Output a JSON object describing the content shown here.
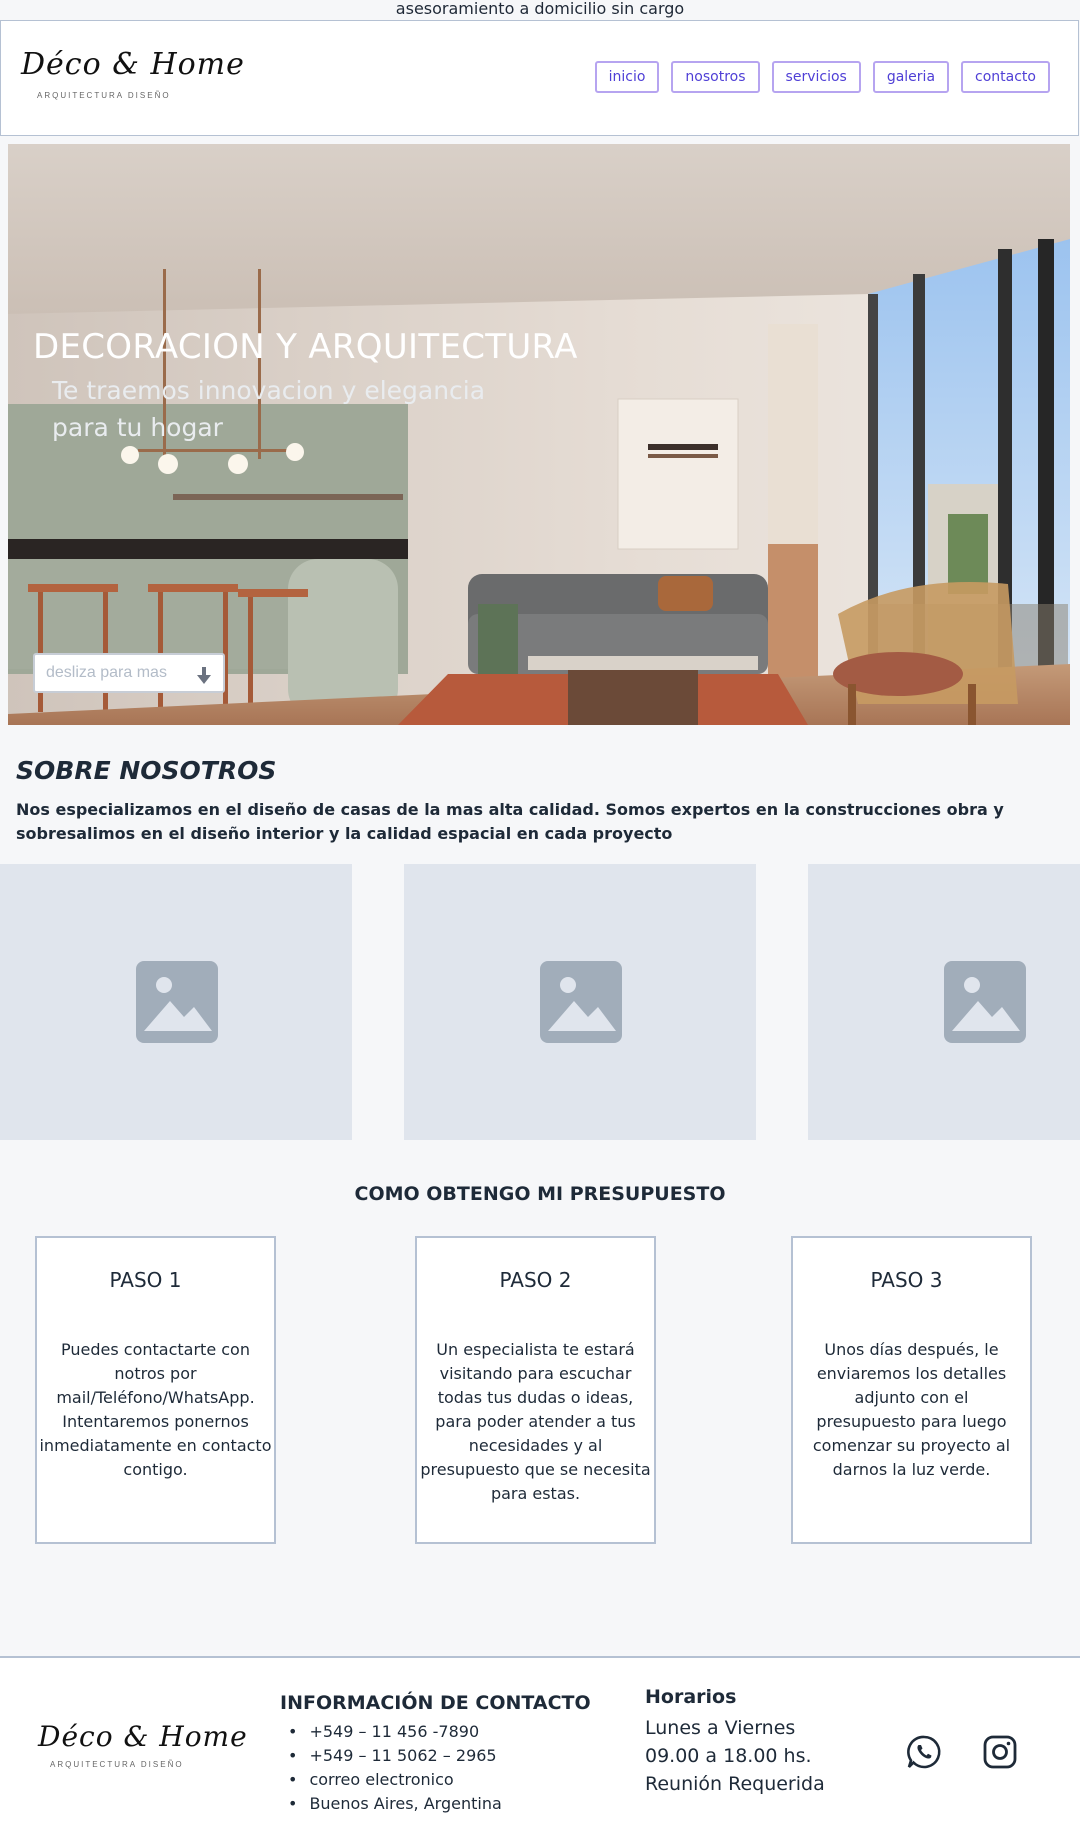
{
  "topbar": {
    "text": "asesoramiento a domicilio sin cargo"
  },
  "brand": {
    "script": "Déco & Home",
    "tagline": "ARQUITECTURA DISEÑO"
  },
  "nav": {
    "items": [
      "inicio",
      "nosotros",
      "servicios",
      "galeria",
      "contacto"
    ],
    "accent": "#4f3fd6"
  },
  "hero": {
    "title": "DECORACION Y ARQUITECTURA",
    "subtitle": "Te traemos innovacion y elegancia para tu hogar",
    "button_label": "desliza para mas",
    "button_icon": "arrow-down-icon"
  },
  "about": {
    "title": "SOBRE NOSOTROS",
    "text": "Nos especializamos en el diseño de casas de la mas alta calidad. Somos expertos en la construcciones obra y sobresalimos en el diseño interior y la calidad espacial en cada proyecto",
    "placeholder_icon": "image-placeholder-icon"
  },
  "steps": {
    "title": "COMO OBTENGO MI PRESUPUESTO",
    "items": [
      {
        "head": "PASO 1",
        "text": "Puedes contactarte con notros por  mail/Teléfono/WhatsApp. Intentaremos ponernos inmediatamente en contacto contigo."
      },
      {
        "head": "PASO 2",
        "text": "Un especialista te estará visitando para escuchar todas tus dudas o ideas, para poder atender a tus necesidades y al presupuesto que se necesita para estas."
      },
      {
        "head": "PASO 3",
        "text": "Unos días después, le enviaremos los detalles adjunto con el presupuesto para luego comenzar su proyecto al darnos la luz verde."
      }
    ]
  },
  "footer": {
    "contact_title": "INFORMACIÓN DE CONTACTO",
    "contact_items": [
      "+549 – 11 456  -7890",
      "+549 – 11 5062 – 2965",
      "correo electronico",
      "Buenos Aires, Argentina"
    ],
    "hours_title": "Horarios",
    "hours_text": "Lunes a Viernes 09.00 a 18.00 hs. Reunión Requerida",
    "social_icons": [
      "whatsapp-icon",
      "instagram-icon"
    ]
  }
}
